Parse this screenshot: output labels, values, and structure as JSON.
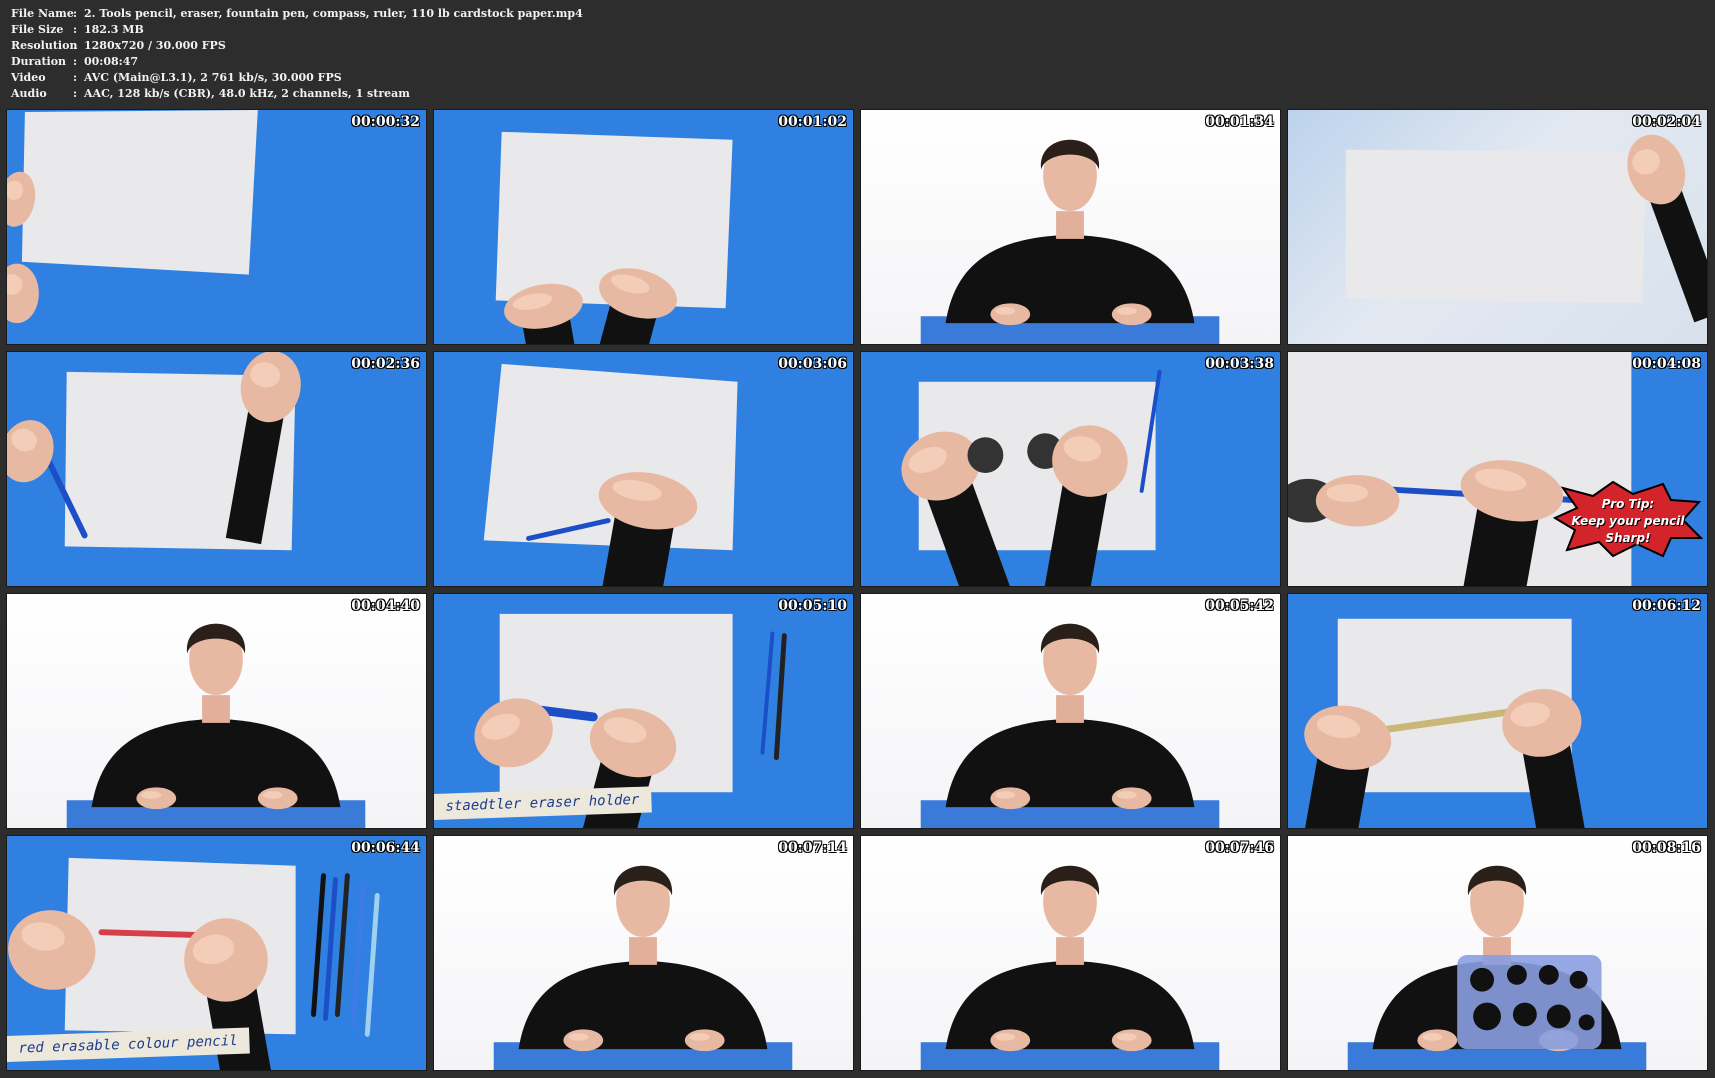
{
  "info": [
    {
      "label": "File Name",
      "sep": ":",
      "value": "2. Tools pencil, eraser, fountain pen, compass, ruler, 110 lb cardstock paper.mp4"
    },
    {
      "label": "File Size",
      "sep": ":",
      "value": "182.3 MB"
    },
    {
      "label": "Resolution",
      "sep": ":",
      "value": "1280x720 / 30.000 FPS"
    },
    {
      "label": "Duration",
      "sep": ":",
      "value": "00:08:47"
    },
    {
      "label": "Video",
      "sep": ":",
      "value": "AVC (Main@L3.1), 2 761 kb/s, 30.000 FPS"
    },
    {
      "label": "Audio",
      "sep": ":",
      "value": "AAC, 128 kb/s (CBR), 48.0 kHz, 2 channels, 1 stream"
    }
  ],
  "colors": {
    "background": "#2d2d2d",
    "blue_backdrop": "#2f80e0",
    "paper": "#e9e9ec",
    "shirt": "#111111",
    "skin": "#e8b9a2"
  },
  "thumbnails": [
    {
      "timestamp": "00:00:32",
      "scene": "paper-hands"
    },
    {
      "timestamp": "00:01:02",
      "scene": "paper-hands-center"
    },
    {
      "timestamp": "00:01:34",
      "scene": "presenter"
    },
    {
      "timestamp": "00:02:04",
      "scene": "paper-fog"
    },
    {
      "timestamp": "00:02:36",
      "scene": "paper-pencil"
    },
    {
      "timestamp": "00:03:06",
      "scene": "paper-hand-pencil"
    },
    {
      "timestamp": "00:03:38",
      "scene": "sharpener"
    },
    {
      "timestamp": "00:04:08",
      "scene": "pro-tip",
      "badge": [
        "Pro Tip:",
        "Keep your pencil Sharp!"
      ]
    },
    {
      "timestamp": "00:04:40",
      "scene": "presenter"
    },
    {
      "timestamp": "00:05:10",
      "scene": "eraser-holder",
      "caption": "staedtler eraser holder"
    },
    {
      "timestamp": "00:05:42",
      "scene": "presenter"
    },
    {
      "timestamp": "00:06:12",
      "scene": "pencil-hold"
    },
    {
      "timestamp": "00:06:44",
      "scene": "colour-pencil",
      "caption": "red erasable colour pencil"
    },
    {
      "timestamp": "00:07:14",
      "scene": "presenter"
    },
    {
      "timestamp": "00:07:46",
      "scene": "presenter"
    },
    {
      "timestamp": "00:08:16",
      "scene": "presenter-template"
    }
  ]
}
